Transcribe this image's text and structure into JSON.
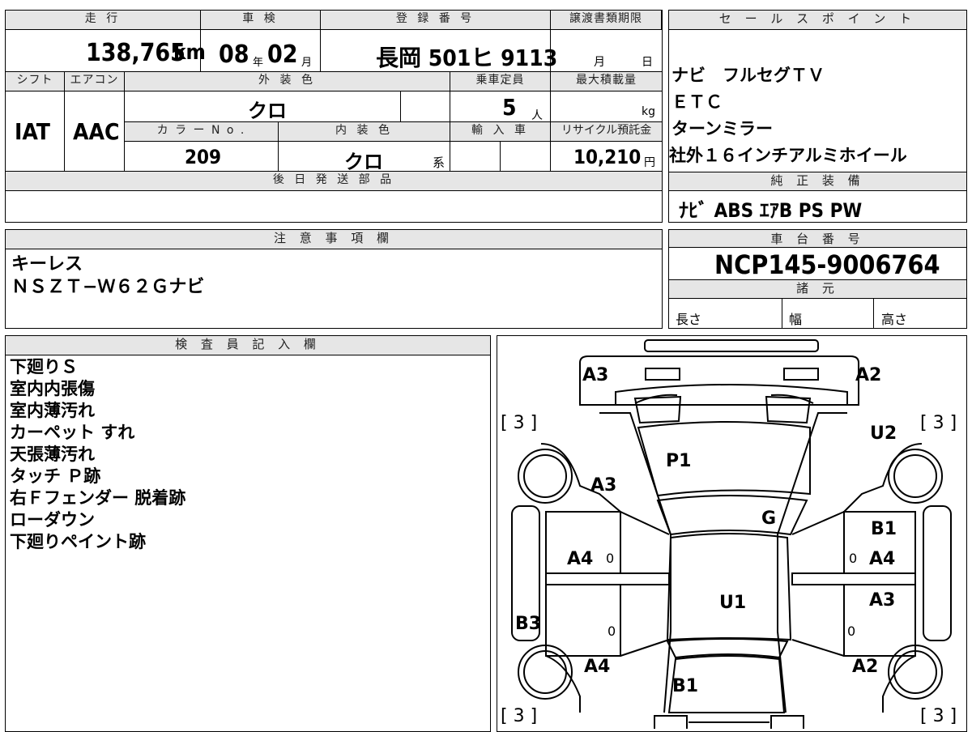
{
  "top": {
    "mileage_label": "走 行",
    "inspection_label": "車 検",
    "registration_label": "登 録 番 号",
    "transfer_deadline_label": "譲渡書類期限",
    "mileage_value": "138,765",
    "mileage_unit": "km",
    "inspection_year": "08",
    "year_unit": "年",
    "inspection_month": "02",
    "month_unit": "月",
    "registration_value": "長岡 501ヒ 9113",
    "deadline_month_unit": "月",
    "deadline_day_unit": "日",
    "shift_label": "シフト",
    "aircon_label": "エアコン",
    "exterior_label": "外 装 色",
    "capacity_label": "乗車定員",
    "max_load_label": "最大積載量",
    "shift_value": "IAT",
    "aircon_value": "AAC",
    "exterior_value": "クロ",
    "capacity_value": "5",
    "capacity_unit": "人",
    "load_unit": "kg",
    "color_no_label": "カ ラ ー N o .",
    "interior_label": "内 装 色",
    "import_label": "輸 入 車",
    "recycle_label": "リサイクル預託金",
    "color_no_value": "209",
    "interior_value": "クロ",
    "interior_suffix": "系",
    "recycle_value": "10,210",
    "recycle_unit": "円",
    "later_parts_label": "後 日 発 送 部 品"
  },
  "sales_points": {
    "label": "セ ー ル ス ポ イ ン ト",
    "items": [
      "ナビ　フルセグＴＶ",
      "ＥＴＣ",
      "ターンミラー",
      "社外１６インチアルミホイール"
    ]
  },
  "equipment": {
    "label": "純 正 装 備",
    "value": "ﾅﾋﾞ  ABS  ｴｱB  PS  PW"
  },
  "notes": {
    "label": "注 意 事 項 欄",
    "lines": [
      "キーレス",
      "ＮＳＺＴ−Ｗ６２Ｇナビ"
    ]
  },
  "chassis": {
    "label": "車 台 番 号",
    "value": "NCP145-9006764",
    "spec_label": "諸 元",
    "length_label": "長さ",
    "width_label": "幅",
    "height_label": "高さ"
  },
  "inspector": {
    "label": "検 査 員 記 入 欄",
    "lines": [
      "下廻りＳ",
      "室内内張傷",
      "室内薄汚れ",
      "カーペット すれ",
      "天張薄汚れ",
      "タッチ Ｐ跡",
      "右Ｆフェンダー 脱着跡",
      "ローダウン",
      "下廻りペイント跡"
    ]
  },
  "diagram": {
    "codes": {
      "a3_top_left": "A3",
      "a2_top_right": "A2",
      "u2_right": "U2",
      "p1": "P1",
      "a3_left": "A3",
      "g": "G",
      "b1_right": "B1",
      "a4_left": "A4",
      "a4_right": "A4",
      "u1": "U1",
      "a3_right": "A3",
      "b3_left": "B3",
      "a4_bottom_left": "A4",
      "a2_bottom_right": "A2",
      "b1_bottom": "B1"
    },
    "tire_marks": [
      "[ 3 ]",
      "[ 3 ]",
      "[ 3 ]",
      "[ 3 ]"
    ],
    "zero_marks": [
      "0",
      "0",
      "0",
      "0"
    ]
  }
}
